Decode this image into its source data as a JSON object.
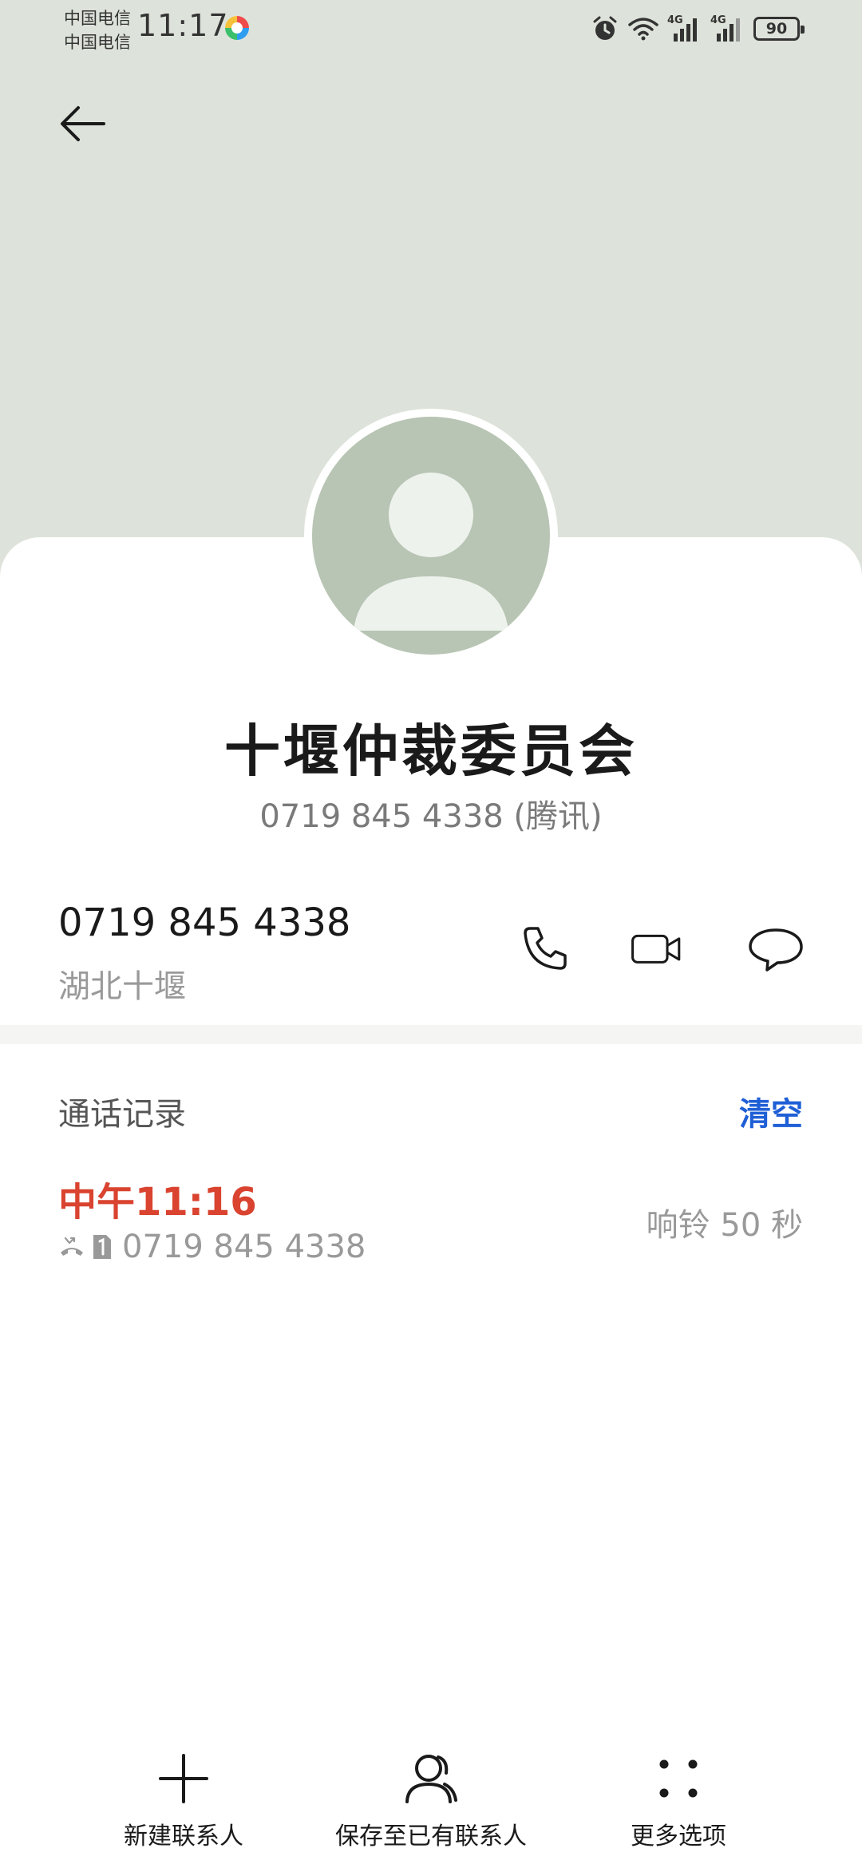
{
  "status_bar": {
    "carrier_1": "中国电信",
    "carrier_2": "中国电信",
    "time": "11:17",
    "network_1": "4G",
    "network_2": "4G",
    "battery": "90",
    "icons": [
      "alarm-icon",
      "wifi-icon",
      "signal-icon",
      "signal-icon",
      "battery-icon"
    ]
  },
  "header": {
    "back_icon": "arrow-left-icon"
  },
  "contact": {
    "name": "十堰仲裁委员会",
    "subtitle": "0719 845 4338 (腾讯)",
    "avatar_icon": "person-avatar-icon",
    "phone": "0719 845 4338",
    "location": "湖北十堰",
    "actions": [
      "phone-icon",
      "video-icon",
      "message-icon"
    ]
  },
  "call_log": {
    "title": "通话记录",
    "clear_label": "清空",
    "entries": [
      {
        "time": "中午11:16",
        "number": "0719 845 4338",
        "duration": "响铃 50 秒",
        "icons": [
          "missed-call-icon",
          "sim-1-icon"
        ]
      }
    ]
  },
  "bottom_bar": {
    "items": [
      {
        "label": "新建联系人",
        "icon": "plus-icon"
      },
      {
        "label": "保存至已有联系人",
        "icon": "contact-icon"
      },
      {
        "label": "更多选项",
        "icon": "more-dots-icon"
      }
    ]
  },
  "colors": {
    "header_bg": "#dde3da",
    "avatar_bg": "#b8c5b4",
    "accent_blue": "#1f5fd6",
    "missed_red": "#d9432f"
  }
}
